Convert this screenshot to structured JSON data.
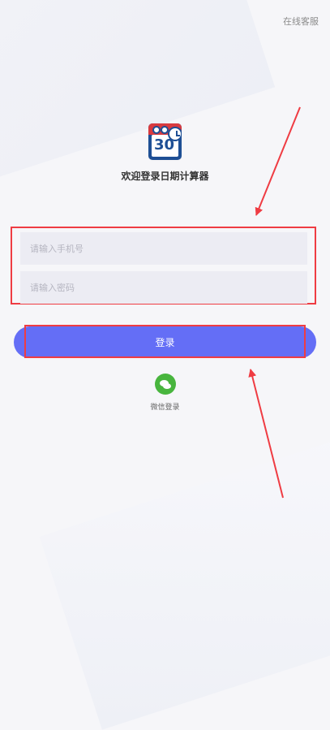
{
  "header": {
    "online_service": "在线客服"
  },
  "brand": {
    "logo_text": "30",
    "welcome": "欢迎登录日期计算器"
  },
  "login_form": {
    "phone_placeholder": "请输入手机号",
    "password_placeholder": "请输入密码",
    "login_button": "登录",
    "wechat_login": "微信登录"
  },
  "colors": {
    "background": "#f6f6f9",
    "primary_button": "#646ef6",
    "highlight_red": "#ef3c43",
    "wechat_green": "#48b53e",
    "logo_blue": "#1e4f95",
    "logo_red": "#d83a3f"
  },
  "icons": {
    "app_logo": "calendar-clock-icon",
    "wechat": "wechat-icon",
    "annotation_arrows": "arrow-icon"
  }
}
